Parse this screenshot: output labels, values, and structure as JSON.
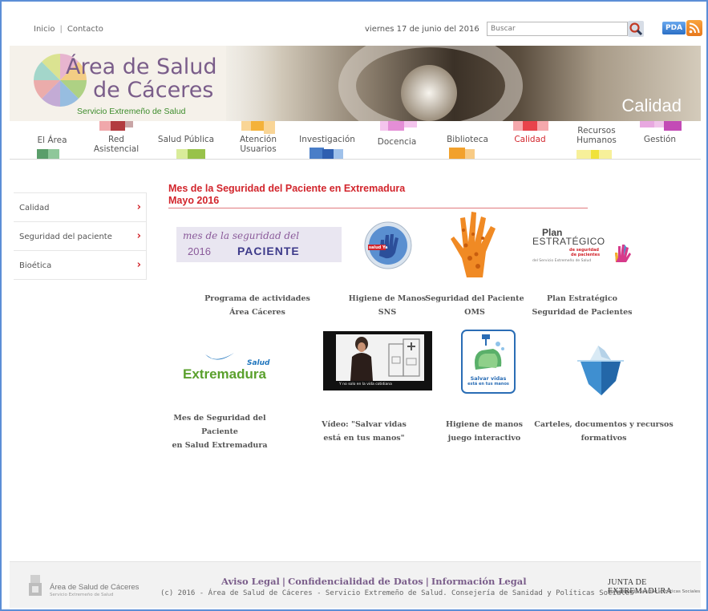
{
  "top": {
    "links": [
      "Inicio",
      "Contacto"
    ],
    "date": "viernes 17 de junio del 2016",
    "search_placeholder": "Buscar",
    "pda_label": "PDA"
  },
  "banner": {
    "title_line1": "Área de Salud",
    "title_line2": "de Cáceres",
    "subtitle": "Servicio Extremeño de Salud",
    "section": "Calidad"
  },
  "nav": {
    "items": [
      {
        "label": "El Área",
        "color": "#5a9e6a"
      },
      {
        "label": "Red\nAsistencial",
        "color": "#b23b3f"
      },
      {
        "label": "Salud Pública",
        "color": "#98c24a"
      },
      {
        "label": "Atención\nUsuarios",
        "color": "#f4b23a"
      },
      {
        "label": "Investigación",
        "color": "#4a7ec8"
      },
      {
        "label": "Docencia",
        "color": "#e48ed6"
      },
      {
        "label": "Biblioteca",
        "color": "#f2a12c"
      },
      {
        "label": "Calidad",
        "color": "#e8434b"
      },
      {
        "label": "Recursos\nHumanos",
        "color": "#f0e23a"
      },
      {
        "label": "Gestión",
        "color": "#c34bb6"
      }
    ],
    "active": "Calidad"
  },
  "sidebar": {
    "items": [
      {
        "label": "Calidad"
      },
      {
        "label": "Seguridad del paciente"
      },
      {
        "label": "Bioética"
      }
    ]
  },
  "content": {
    "title_line1": "Mes de la Seguridad del Paciente en Extremadura",
    "title_line2": "Mayo 2016",
    "tiles": [
      {
        "caption": [
          "Programa de actividades",
          "Área Cáceres"
        ],
        "image_text_a": "mes de la seguridad del",
        "image_text_b": "2016",
        "image_text_c": "PACIENTE"
      },
      {
        "caption": [
          "Higiene de Manos",
          "SNS"
        ],
        "image_text": "salud Ya"
      },
      {
        "caption": [
          "Seguridad del Paciente",
          "OMS"
        ]
      },
      {
        "caption": [
          "Plan Estratégico",
          "Seguridad de Pacientes"
        ],
        "image_text_a": "Plan",
        "image_text_b": "ESTRATÉGICO",
        "image_text_c": "de seguridad",
        "image_text_d": "de pacientes",
        "image_text_e": "del Servicio Extremeño de Salud"
      },
      {
        "caption": [
          "Mes de Seguridad del",
          "Paciente",
          "en Salud Extremadura"
        ],
        "image_text_a": "Salud",
        "image_text_b": "Extremadura"
      },
      {
        "caption": [
          "Vídeo: \"Salvar vidas",
          "está en tus manos\""
        ],
        "image_text": "Y no solo en la vida cotidiana"
      },
      {
        "caption": [
          "Higiene de manos",
          "juego interactivo"
        ],
        "image_text_a": "Salvar vidas",
        "image_text_b": "está en tus manos"
      },
      {
        "caption": [
          "Carteles, documentos y recursos",
          "formativos"
        ]
      }
    ]
  },
  "footer": {
    "logo_title": "Área de Salud de Cáceres",
    "logo_sub": "Servicio Extremeño de Salud",
    "links": [
      "Aviso Legal",
      "Confidencialidad de Datos",
      "Información Legal"
    ],
    "copyright": "(c) 2016 - Área de Salud de Cáceres - Servicio Extremeño de Salud. Consejería de Sanidad y Políticas Sociales",
    "junta_title": "JUNTA DE EXTREMADURA",
    "junta_sub": "Consejería de Sanidad y Políticas Sociales"
  }
}
